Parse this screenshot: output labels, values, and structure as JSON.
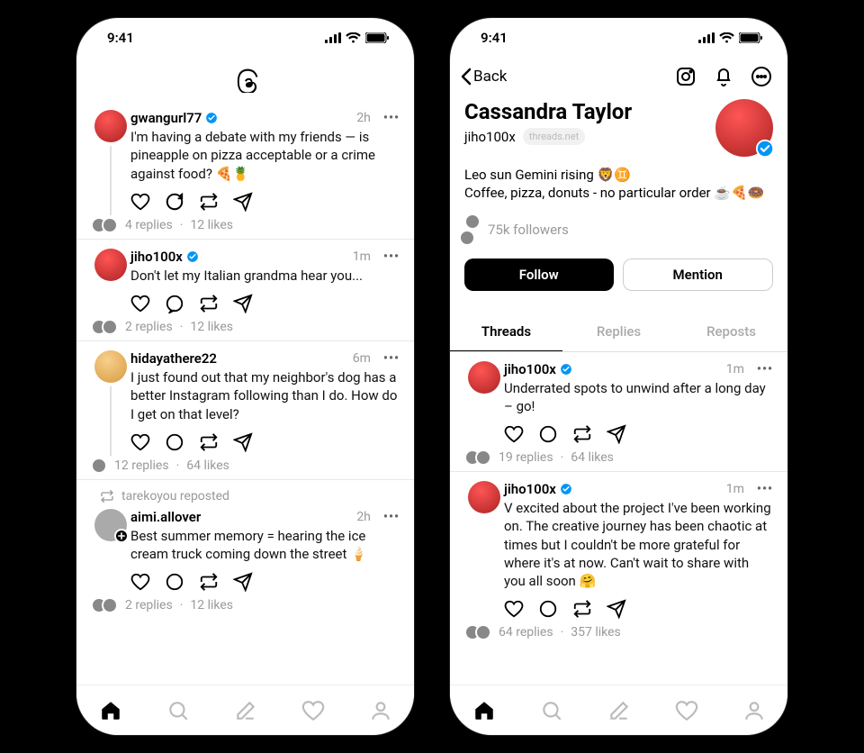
{
  "status": {
    "time": "9:41"
  },
  "feed": {
    "posts": [
      {
        "user": "gwangurl77",
        "verified": true,
        "time": "2h",
        "text": "I'm having a debate with my friends — is pineapple on pizza acceptable or a crime against food? 🍕🍍",
        "replies": "4 replies",
        "likes": "12 likes",
        "thread_line": true,
        "avatar_class": "av-red"
      },
      {
        "user": "jiho100x",
        "verified": true,
        "time": "1m",
        "text": "Don't let my Italian grandma hear you...",
        "replies": "2 replies",
        "likes": "12 likes",
        "avatar_class": "av-red"
      },
      {
        "user": "hidayathere22",
        "verified": false,
        "time": "6m",
        "text": "I just found out that my neighbor's dog has a better Instagram following than I do. How do I get on that level?",
        "replies": "12 replies",
        "likes": "64 likes",
        "avatar_class": "av-orange",
        "thread_line": true
      },
      {
        "repost_by": "tarekoyou reposted",
        "user": "aimi.allover",
        "verified": false,
        "time": "2h",
        "text": "Best summer memory = hearing the ice cream truck coming down the street 🍦",
        "replies": "2 replies",
        "likes": "12 likes",
        "avatar_class": "av-gray",
        "add_badge": true
      }
    ]
  },
  "profile": {
    "back_label": "Back",
    "display_name": "Cassandra Taylor",
    "handle": "jiho100x",
    "domain": "threads.net",
    "bio_line1": "Leo sun Gemini rising 🦁♊",
    "bio_line2": "Coffee, pizza, donuts - no particular order ☕🍕🍩",
    "followers": "75k followers",
    "follow_btn": "Follow",
    "mention_btn": "Mention",
    "tabs": [
      "Threads",
      "Replies",
      "Reposts"
    ],
    "posts": [
      {
        "user": "jiho100x",
        "verified": true,
        "time": "1m",
        "text": "Underrated spots to unwind after a long day – go!",
        "replies": "19 replies",
        "likes": "64 likes"
      },
      {
        "user": "jiho100x",
        "verified": true,
        "time": "1m",
        "text": "V excited about the project I've been working on. The creative journey has been chaotic at times but I couldn't be more grateful for where it's at now. Can't wait to share with you all soon 🤗",
        "replies": "64 replies",
        "likes": "357 likes"
      }
    ]
  }
}
